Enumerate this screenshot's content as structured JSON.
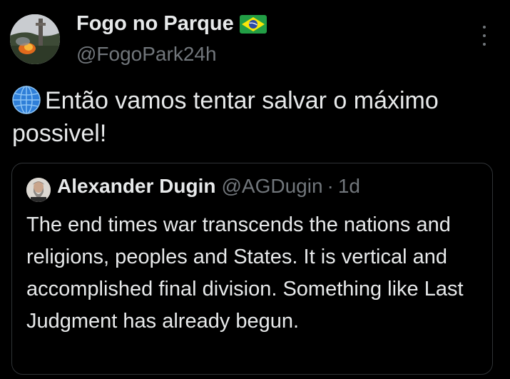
{
  "tweet": {
    "author_name": "Fogo no Parque",
    "author_flag_icon": "brazil-flag-icon",
    "author_handle": "@FogoPark24h",
    "more_icon": "more-options-icon",
    "text_icon": "globe-icon",
    "text": "Então vamos tentar salvar o máximo possivel!"
  },
  "quoted_tweet": {
    "author_name": "Alexander Dugin",
    "author_handle": "@AGDugin",
    "separator": "·",
    "time": "1d",
    "text": "The end times war transcends the nations and religions, peoples and States. It is vertical and accomplished final division. Something like Last Judgment has already begun."
  },
  "colors": {
    "background": "#000000",
    "primary_text": "#e7e9ea",
    "secondary_text": "#71767b",
    "border": "#2f3336"
  }
}
